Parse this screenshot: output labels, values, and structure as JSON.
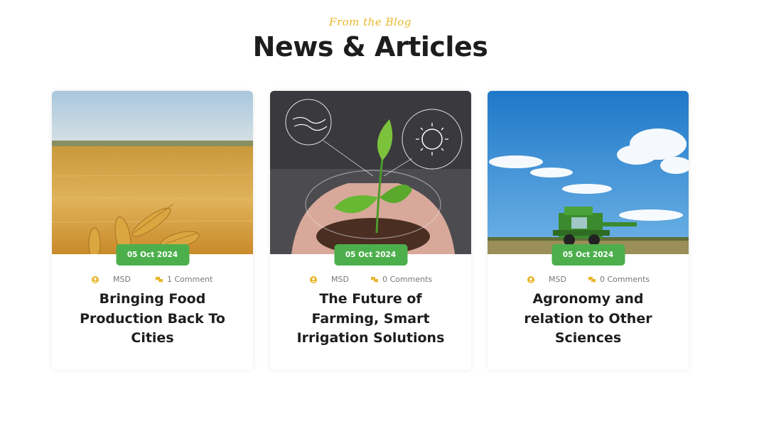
{
  "header": {
    "eyebrow": "From the Blog",
    "title": "News & Articles"
  },
  "colors": {
    "accent": "#e8b62c",
    "badge": "#4caf4c",
    "heading": "#1d1d1d"
  },
  "articles": [
    {
      "date": "05 Oct 2024",
      "author": "MSD",
      "comments": "1 Comment",
      "title": "Bringing Food Production Back To Cities",
      "image": "wheat-field-photo"
    },
    {
      "date": "05 Oct 2024",
      "author": "MSD",
      "comments": "0 Comments",
      "title": "The Future of Farming, Smart Irrigation Solutions",
      "image": "hands-holding-seedling-photo"
    },
    {
      "date": "05 Oct 2024",
      "author": "MSD",
      "comments": "0 Comments",
      "title": "Agronomy and relation to Other Sciences",
      "image": "combine-harvester-photo"
    }
  ]
}
